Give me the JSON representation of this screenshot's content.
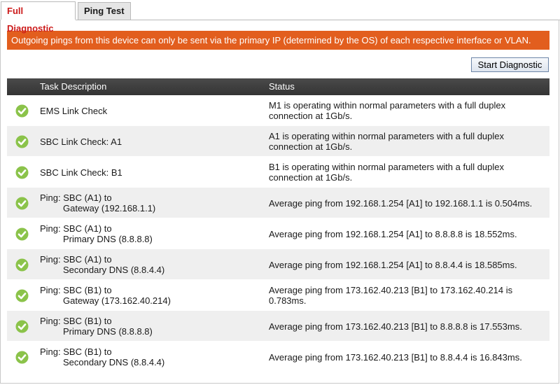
{
  "tabs": [
    {
      "label": "Full Diagnostic",
      "active": true
    },
    {
      "label": "Ping Test",
      "active": false
    }
  ],
  "banner": "Outgoing pings from this device can only be sent via the primary IP (determined by the OS) of each respective interface or VLAN.",
  "start_button": "Start Diagnostic",
  "table": {
    "headers": {
      "task": "Task Description",
      "status": "Status"
    },
    "rows": [
      {
        "task": [
          "EMS Link Check"
        ],
        "status": "M1 is operating within normal parameters with a full duplex connection at 1Gb/s.",
        "icon": "check-circle-icon"
      },
      {
        "task": [
          "SBC Link Check: A1"
        ],
        "status": "A1 is operating within normal parameters with a full duplex connection at 1Gb/s.",
        "icon": "check-circle-icon"
      },
      {
        "task": [
          "SBC Link Check: B1"
        ],
        "status": "B1 is operating within normal parameters with a full duplex connection at 1Gb/s.",
        "icon": "check-circle-icon"
      },
      {
        "task": [
          "Ping: SBC (A1) to",
          "Gateway (192.168.1.1)"
        ],
        "status": "Average ping from 192.168.1.254 [A1] to 192.168.1.1 is 0.504ms.",
        "icon": "check-circle-icon"
      },
      {
        "task": [
          "Ping: SBC (A1) to",
          "Primary DNS (8.8.8.8)"
        ],
        "status": "Average ping from 192.168.1.254 [A1] to 8.8.8.8 is 18.552ms.",
        "icon": "check-circle-icon"
      },
      {
        "task": [
          "Ping: SBC (A1) to",
          "Secondary DNS (8.8.4.4)"
        ],
        "status": "Average ping from 192.168.1.254 [A1] to 8.8.4.4 is 18.585ms.",
        "icon": "check-circle-icon"
      },
      {
        "task": [
          "Ping: SBC (B1) to",
          "Gateway (173.162.40.214)"
        ],
        "status": "Average ping from 173.162.40.213 [B1] to 173.162.40.214 is 0.783ms.",
        "icon": "check-circle-icon"
      },
      {
        "task": [
          "Ping: SBC (B1) to",
          "Primary DNS (8.8.8.8)"
        ],
        "status": "Average ping from 173.162.40.213 [B1] to 8.8.8.8 is 17.553ms.",
        "icon": "check-circle-icon"
      },
      {
        "task": [
          "Ping: SBC (B1) to",
          "Secondary DNS (8.8.4.4)"
        ],
        "status": "Average ping from 173.162.40.213 [B1] to 8.8.4.4 is 16.843ms.",
        "icon": "check-circle-icon"
      }
    ]
  },
  "colors": {
    "banner_bg": "#e25e1e",
    "active_tab_text": "#cc1a1a",
    "header_bg": "#3c3c3c",
    "check_green": "#8bc34a"
  }
}
